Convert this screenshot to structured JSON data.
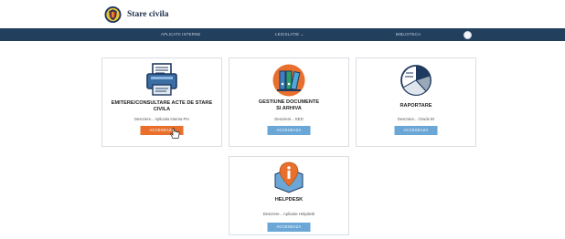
{
  "header": {
    "title": "Stare civila"
  },
  "nav": {
    "items": [
      "APLICATII INTERNE",
      "LEGISLATIE ⌄",
      "BIBLIOTECA"
    ]
  },
  "cards": [
    {
      "title_line1": "EMITERE/CONSULTARE ACTE DE STARE",
      "title_line2": "CIVILA",
      "description": "Descriere... Aplicatia Interna PAI",
      "button": "ACCESEAZA",
      "icon": "document-printer-icon"
    },
    {
      "title_line1": "GESTIUNE DOCUMENTE",
      "title_line2": "SI ARHIVA",
      "description": "Descriere... EED",
      "button": "ACCESEAZA",
      "icon": "binders-icon"
    },
    {
      "title_line1": "RAPORTARE",
      "title_line2": "",
      "description": "Descriere... Oracle BI",
      "button": "ACCESEAZA",
      "icon": "pie-chart-icon"
    },
    {
      "title_line1": "HELPDESK",
      "title_line2": "",
      "description": "Descriere... Aplicatie Helpdesk",
      "button": "ACCESEAZA",
      "icon": "info-pin-icon"
    }
  ],
  "colors": {
    "navbar": "#233f5e",
    "button": "#6aa6d6",
    "button_active": "#e86f2c",
    "accent_orange": "#e86f2c"
  }
}
